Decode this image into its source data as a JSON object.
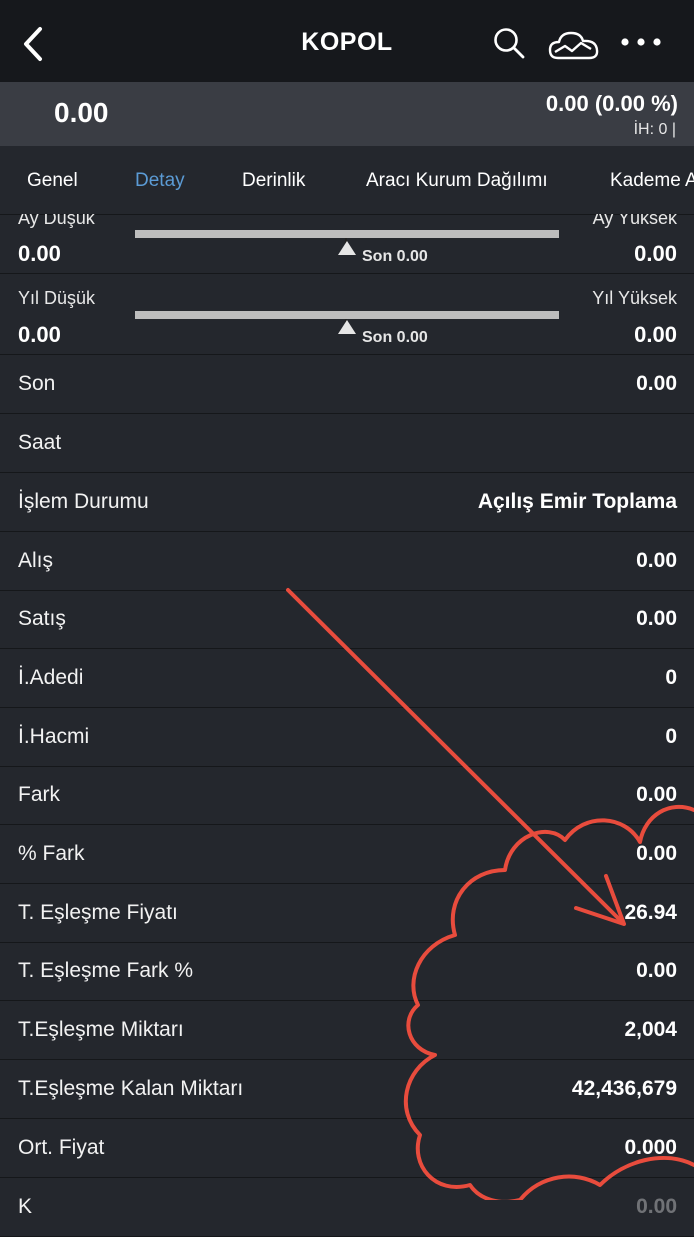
{
  "header": {
    "title": "KOPOL"
  },
  "price": {
    "last": "0.00",
    "change": "0.00 (0.00 %)",
    "ih": "İH:  0 |"
  },
  "tabs": [
    "Genel",
    "Detay",
    "Derinlik",
    "Aracı Kurum Dağılımı",
    "Kademe A"
  ],
  "active_tab": "Detay",
  "ranges": {
    "month": {
      "low_label": "Ay Düşük",
      "low_value": "0.00",
      "high_label": "Ay Yüksek",
      "high_value": "0.00",
      "son": "Son 0.00"
    },
    "year": {
      "low_label": "Yıl Düşük",
      "low_value": "0.00",
      "high_label": "Yıl Yüksek",
      "high_value": "0.00",
      "son": "Son 0.00"
    }
  },
  "rows": [
    {
      "label": "Son",
      "value": "0.00"
    },
    {
      "label": "Saat",
      "value": ""
    },
    {
      "label": "İşlem Durumu",
      "value": "Açılış Emir Toplama"
    },
    {
      "label": "Alış",
      "value": "0.00"
    },
    {
      "label": "Satış",
      "value": "0.00"
    },
    {
      "label": "İ.Adedi",
      "value": "0"
    },
    {
      "label": "İ.Hacmi",
      "value": "0"
    },
    {
      "label": "Fark",
      "value": "0.00"
    },
    {
      "label": "% Fark",
      "value": "0.00"
    },
    {
      "label": "T. Eşleşme Fiyatı",
      "value": "26.94"
    },
    {
      "label": "T. Eşleşme Fark %",
      "value": "0.00"
    },
    {
      "label": "T.Eşleşme Miktarı",
      "value": "2,004"
    },
    {
      "label": "T.Eşleşme Kalan Miktarı",
      "value": "42,436,679"
    },
    {
      "label": "Ort. Fiyat",
      "value": "0.000"
    },
    {
      "label": "K",
      "value": "0.00"
    }
  ],
  "colors": {
    "accent": "#5b9bd5",
    "annotation": "#e84c3d",
    "background": "#24272d",
    "header": "#16181c"
  },
  "icons": [
    "back-chevron-icon",
    "search-icon",
    "cloud-chart-icon",
    "more-icon"
  ]
}
